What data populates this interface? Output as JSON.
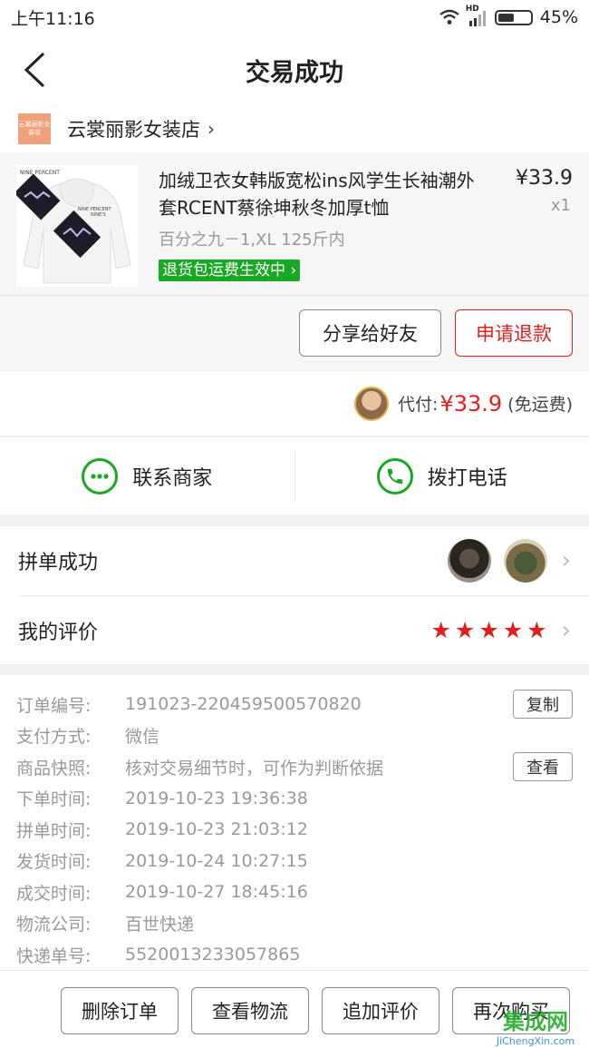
{
  "status_bar": {
    "time": "上午11:16",
    "network": "HD",
    "battery": "45%"
  },
  "header": {
    "title": "交易成功"
  },
  "shop": {
    "name": "云裳丽影女装店",
    "logo_text": "云裳丽影女装店"
  },
  "goods": {
    "title": "加绒卫衣女韩版宽松ins风学生长袖潮外套RCENT蔡徐坤秋冬加厚t恤",
    "price": "¥33.9",
    "qty": "x1",
    "sku": "百分之九－1,XL 125斤内",
    "tag": "退货包运费生效中",
    "img_text_top": "NINE PERCENT",
    "img_text_mid": "NINE PERCENT",
    "img_text_sub": "NINE'S"
  },
  "actions": {
    "share": "分享给好友",
    "refund": "申请退款"
  },
  "payment": {
    "label": "代付:",
    "amount": "¥33.9",
    "note": "(免运费)"
  },
  "contact": {
    "merchant": "联系商家",
    "call": "拨打电话"
  },
  "group": {
    "success_label": "拼单成功",
    "review_label": "我的评价",
    "rating": 5
  },
  "details": {
    "rows": [
      {
        "label": "订单编号:",
        "value": "191023-220459500570820",
        "button": "复制"
      },
      {
        "label": "支付方式:",
        "value": "微信"
      },
      {
        "label": "商品快照:",
        "value": "核对交易细节时，可作为判断依据",
        "button": "查看"
      },
      {
        "label": "下单时间:",
        "value": "2019-10-23 19:36:38"
      },
      {
        "label": "拼单时间:",
        "value": "2019-10-23 21:03:12"
      },
      {
        "label": "发货时间:",
        "value": "2019-10-24 10:27:15"
      },
      {
        "label": "成交时间:",
        "value": "2019-10-27 18:45:16"
      },
      {
        "label": "物流公司:",
        "value": "百世快递"
      },
      {
        "label": "快递单号:",
        "value": "5520013233057865"
      }
    ]
  },
  "bottom": {
    "delete": "删除订单",
    "logistics": "查看物流",
    "add_review": "追加评价",
    "rebuy": "再次购买"
  },
  "watermark": {
    "logo": "集成网",
    "url": "JiChengXin.com"
  },
  "colors": {
    "accent_red": "#e0201e",
    "green": "#19a823"
  }
}
